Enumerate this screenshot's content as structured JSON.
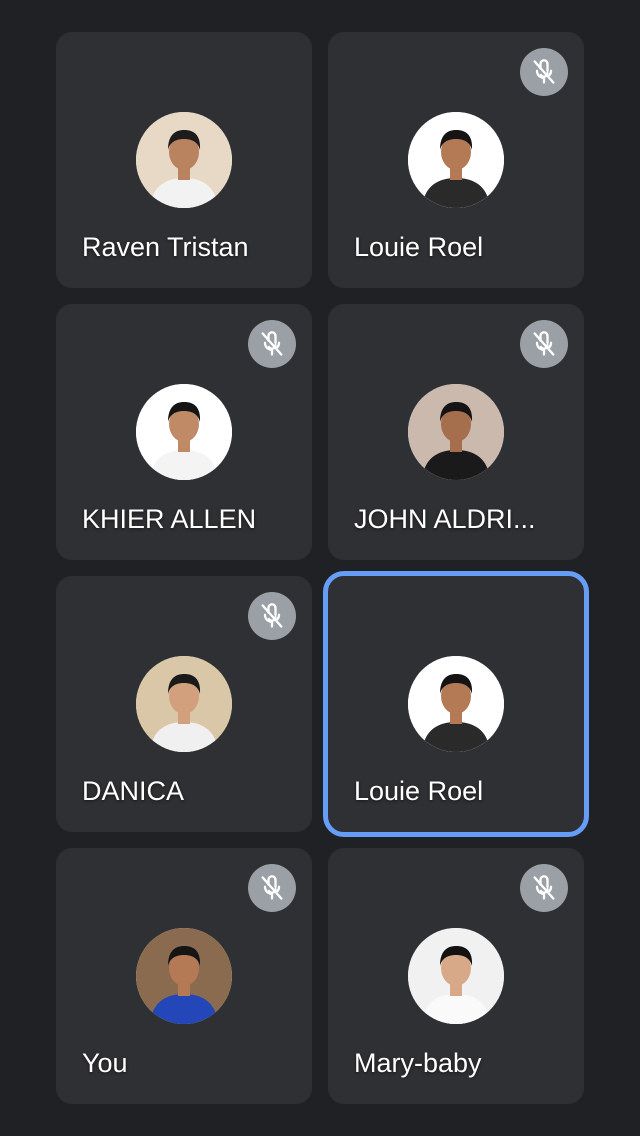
{
  "participants": [
    {
      "name": "Raven Tristan",
      "muted": false,
      "active": false,
      "avatar_icon": "user-photo-icon",
      "bg": "#e8d9c6",
      "shirt": "#f2f2f2",
      "skin": "#b98360",
      "hair": "#1c1c1c"
    },
    {
      "name": "Louie Roel",
      "muted": true,
      "active": false,
      "avatar_icon": "user-photo-icon",
      "bg": "#ffffff",
      "shirt": "#2a2a2a",
      "skin": "#b47a55",
      "hair": "#141414"
    },
    {
      "name": "KHIER ALLEN",
      "muted": true,
      "active": false,
      "avatar_icon": "user-photo-icon",
      "bg": "#ffffff",
      "shirt": "#f4f4f4",
      "skin": "#c08a66",
      "hair": "#151515"
    },
    {
      "name": "JOHN ALDRI...",
      "muted": true,
      "active": false,
      "avatar_icon": "user-photo-icon",
      "bg": "#cbb9ad",
      "shirt": "#1a1a1a",
      "skin": "#a56e4d",
      "hair": "#141414"
    },
    {
      "name": "DANICA",
      "muted": true,
      "active": false,
      "avatar_icon": "user-photo-icon",
      "bg": "#d9c7a8",
      "shirt": "#f0f0f0",
      "skin": "#d2a07c",
      "hair": "#1a1a1a"
    },
    {
      "name": "Louie Roel",
      "muted": false,
      "active": true,
      "avatar_icon": "user-photo-icon",
      "bg": "#ffffff",
      "shirt": "#2a2a2a",
      "skin": "#b47a55",
      "hair": "#141414"
    },
    {
      "name": "You",
      "muted": true,
      "active": false,
      "avatar_icon": "user-photo-icon",
      "bg": "#8a6b50",
      "shirt": "#2346b8",
      "skin": "#b47a55",
      "hair": "#151515"
    },
    {
      "name": "Mary-baby",
      "muted": true,
      "active": false,
      "avatar_icon": "user-photo-icon",
      "bg": "#f1f1f1",
      "shirt": "#fafafa",
      "skin": "#d8a988",
      "hair": "#121212"
    }
  ],
  "colors": {
    "background": "#202124",
    "tile": "#2f3033",
    "active_border": "#669df6",
    "mute_badge": "#9aa0a6"
  },
  "mute_icon": "mic-off-icon"
}
